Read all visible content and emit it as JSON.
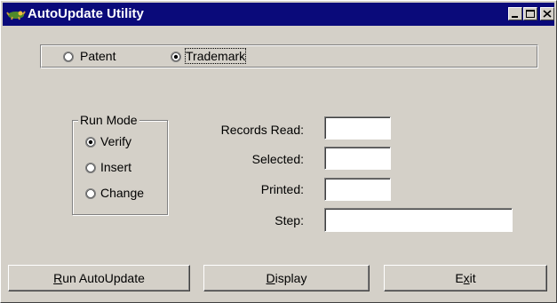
{
  "window": {
    "title": "AutoUpdate Utility",
    "icon": "app-icon",
    "controls": [
      "minimize-icon",
      "maximize-icon",
      "close-icon"
    ]
  },
  "source": {
    "options": [
      {
        "label": "Patent",
        "checked": false
      },
      {
        "label": "Trademark",
        "checked": true
      }
    ]
  },
  "run_mode": {
    "legend": "Run Mode",
    "options": [
      {
        "label": "Verify",
        "checked": true
      },
      {
        "label": "Insert",
        "checked": false
      },
      {
        "label": "Change",
        "checked": false
      }
    ]
  },
  "stats": {
    "records_read_label": "Records Read:",
    "records_read_value": "",
    "selected_label": "Selected:",
    "selected_value": "",
    "printed_label": "Printed:",
    "printed_value": "",
    "step_label": "Step:",
    "step_value": ""
  },
  "buttons": {
    "run": {
      "accel": "R",
      "rest": "un AutoUpdate"
    },
    "display": {
      "accel": "D",
      "rest": "isplay"
    },
    "exit": {
      "pre": "E",
      "accel": "x",
      "rest": "it"
    }
  },
  "colors": {
    "titlebar": "#0a0a7a",
    "face": "#d4d0c8"
  }
}
